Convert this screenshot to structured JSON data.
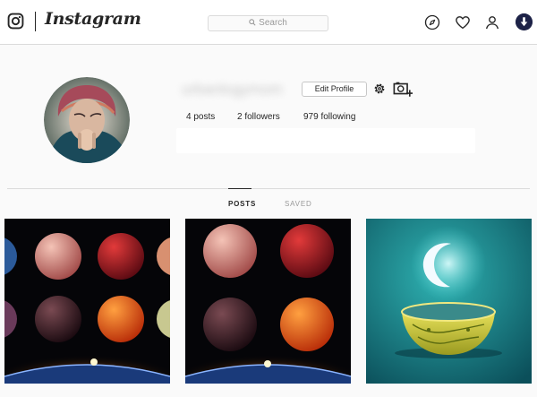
{
  "nav": {
    "brand": "Instagram",
    "search_placeholder": "Search",
    "icons": [
      "instagram-glyph-icon",
      "search-icon",
      "compass-icon",
      "heart-icon",
      "user-icon"
    ]
  },
  "profile": {
    "username": "urbanlogymom",
    "edit_label": "Edit Profile",
    "posts": "4 posts",
    "followers": "2 followers",
    "following": "979 following"
  },
  "tabs": [
    {
      "label": "POSTS",
      "active": true
    },
    {
      "label": "SAVED",
      "active": false
    }
  ],
  "grid": {
    "posts": [
      {
        "subject": "colored planets over earth horizon"
      },
      {
        "subject": "colored planets over earth horizon"
      },
      {
        "subject": "crescent moon above ornate golden bowl"
      }
    ]
  },
  "colors": {
    "text": "#262626",
    "muted": "#999999",
    "border": "#dbdbdb",
    "background": "#fafafa"
  }
}
